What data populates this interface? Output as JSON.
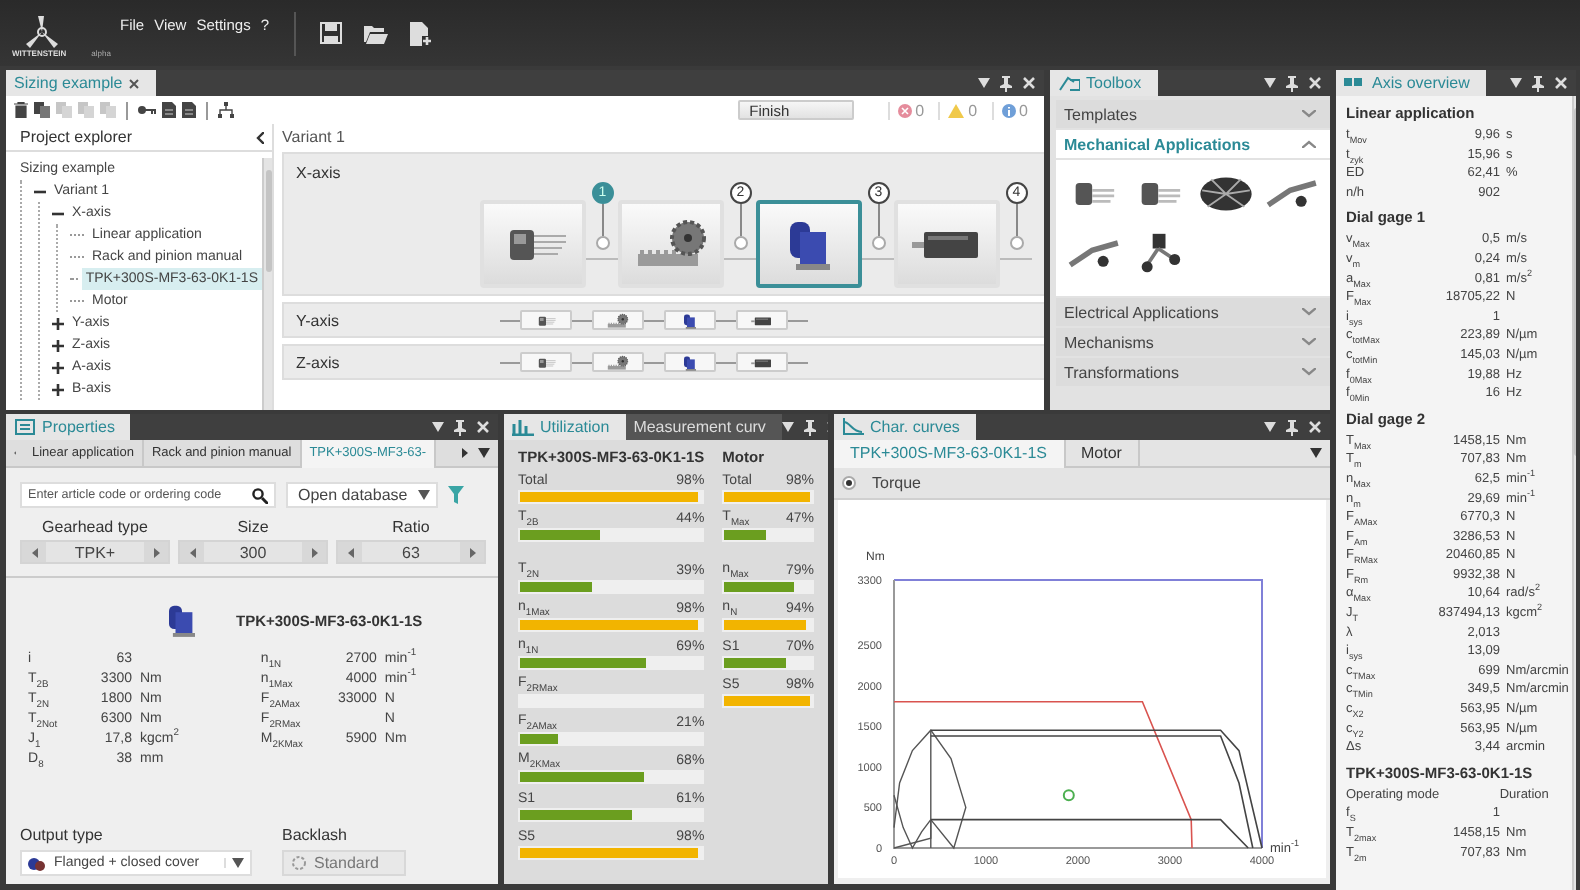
{
  "app": {
    "brand": "WITTENSTEIN",
    "edition": "alpha",
    "menu": [
      "File",
      "View",
      "Settings",
      "?"
    ],
    "toolbar": [
      {
        "kind": "save"
      },
      {
        "kind": "open"
      },
      {
        "kind": "new"
      }
    ]
  },
  "sizing": {
    "tabs": [
      {
        "label": "Sizing example",
        "selected": true
      }
    ],
    "toolbar_groups": [
      {
        "tools": [
          {
            "kind": "delete",
            "disabled": false
          },
          {
            "kind": "copy",
            "disabled": false
          },
          {
            "kind": "copy",
            "disabled": true
          },
          {
            "kind": "copy",
            "disabled": true
          },
          {
            "kind": "copy",
            "disabled": true
          }
        ]
      },
      {
        "tools": [
          {
            "kind": "key",
            "disabled": false
          },
          {
            "kind": "document",
            "disabled": false
          },
          {
            "kind": "document",
            "disabled": false
          }
        ]
      },
      {
        "tools": [
          {
            "kind": "tree",
            "disabled": false
          }
        ]
      }
    ],
    "finish": "Finish",
    "counters": [
      {
        "kind": "error",
        "count": "0"
      },
      {
        "kind": "warning",
        "count": "0"
      },
      {
        "kind": "info",
        "count": "0"
      }
    ],
    "explorer": {
      "title": "Project explorer",
      "tree": [
        {
          "label": "Sizing example",
          "selected": false,
          "children": [
            {
              "label": "Variant 1",
              "expanded": true,
              "selected": false,
              "children": [
                {
                  "label": "X-axis",
                  "expanded": true,
                  "selected": false,
                  "children": [
                    {
                      "label": "Linear application",
                      "selected": false
                    },
                    {
                      "label": "Rack and pinion manual",
                      "selected": false
                    },
                    {
                      "label": "TPK+300S-MF3-63-0K1-1S",
                      "selected": true
                    },
                    {
                      "label": "Motor",
                      "selected": false
                    }
                  ]
                },
                {
                  "label": "Y-axis",
                  "expanded": false,
                  "selected": false
                },
                {
                  "label": "Z-axis",
                  "expanded": false,
                  "selected": false
                },
                {
                  "label": "A-axis",
                  "expanded": false,
                  "selected": false
                },
                {
                  "label": "B-axis",
                  "expanded": false,
                  "selected": false
                }
              ]
            }
          ]
        }
      ]
    },
    "variant": "Variant 1",
    "axes": [
      {
        "label": "X-axis",
        "expanded": true,
        "components": [
          {
            "kind": "application",
            "selected": false,
            "marker": {
              "label": "1",
              "selected": true
            }
          },
          {
            "kind": "rack",
            "selected": false,
            "marker": {
              "label": "2",
              "selected": false
            }
          },
          {
            "kind": "gearbox",
            "selected": true,
            "marker": {
              "label": "3",
              "selected": false
            }
          },
          {
            "kind": "motor",
            "selected": false,
            "marker": {
              "label": "4",
              "selected": false
            }
          }
        ]
      },
      {
        "label": "Y-axis",
        "expanded": false,
        "components": [
          {
            "kind": "application",
            "selected": false
          },
          {
            "kind": "rack",
            "selected": false
          },
          {
            "kind": "gearbox",
            "selected": false
          },
          {
            "kind": "motor",
            "selected": false
          }
        ]
      },
      {
        "label": "Z-axis",
        "expanded": false,
        "components": [
          {
            "kind": "application",
            "selected": false
          },
          {
            "kind": "rack",
            "selected": false
          },
          {
            "kind": "gearbox",
            "selected": false
          },
          {
            "kind": "motor",
            "selected": false
          }
        ]
      }
    ]
  },
  "toolbox": {
    "title": "Toolbox",
    "sections": [
      {
        "label": "Templates",
        "expanded": false
      },
      {
        "label": "Mechanical Applications",
        "expanded": true,
        "tools": [
          {
            "kind": "linear"
          },
          {
            "kind": "linear"
          },
          {
            "kind": "rotary"
          },
          {
            "kind": "crane"
          },
          {
            "kind": "crane"
          },
          {
            "kind": "robot"
          }
        ]
      },
      {
        "label": "Electrical Applications",
        "expanded": false
      },
      {
        "label": "Mechanisms",
        "expanded": false
      },
      {
        "label": "Transformations",
        "expanded": false
      }
    ]
  },
  "properties": {
    "tabs": [
      {
        "label": "Properties",
        "selected": true
      }
    ],
    "subtabs": [
      {
        "label": "Linear application",
        "selected": false
      },
      {
        "label": "Rack and pinion manual",
        "selected": false
      },
      {
        "label": "TPK+300S-MF3-63-",
        "selected": true
      }
    ],
    "search": {
      "placeholder": "Enter article code or ordering code"
    },
    "database": "Open database",
    "selectors": [
      {
        "label": "Gearhead type",
        "value": "TPK+"
      },
      {
        "label": "Size",
        "value": "300"
      },
      {
        "label": "Ratio",
        "value": "63"
      }
    ],
    "product": "TPK+300S-MF3-63-0K1-1S",
    "specs_left": [
      {
        "name": "i",
        "value": "63"
      },
      {
        "name": "T$_{2B}$",
        "value": "3300",
        "unit": "Nm"
      },
      {
        "name": "T$_{2N}$",
        "value": "1800",
        "unit": "Nm"
      },
      {
        "name": "T$_{2Not}$",
        "value": "6300",
        "unit": "Nm"
      },
      {
        "name": "J$_{1}$",
        "value": "17,8",
        "unit": "kgcm$^{2}$"
      },
      {
        "name": "D$_{8}$",
        "value": "38",
        "unit": "mm"
      }
    ],
    "specs_right": [
      {
        "name": "n$_{1N}$",
        "value": "2700",
        "unit": "min$^{-1}$"
      },
      {
        "name": "n$_{1Max}$",
        "value": "4000",
        "unit": "min$^{-1}$"
      },
      {
        "name": "F$_{2AMax}$",
        "value": "33000",
        "unit": "N"
      },
      {
        "name": "F$_{2RMax}$",
        "unit": "N"
      },
      {
        "name": "M$_{2KMax}$",
        "value": "5900",
        "unit": "Nm"
      }
    ],
    "output_type": {
      "label": "Output type",
      "value": "Flanged + closed cover"
    },
    "backlash": {
      "label": "Backlash",
      "value": "Standard"
    }
  },
  "utilization": {
    "tabs": [
      {
        "label": "Utilization",
        "selected": true
      },
      {
        "label": "Measurement curv",
        "selected": false
      }
    ],
    "columns": [
      {
        "title": "TPK+300S-MF3-63-0K1-1S",
        "bars": [
          {
            "name": "Total",
            "value": "98%",
            "level": 0.98,
            "color": "#f2b400"
          },
          {
            "name": "T$_{2B}$",
            "value": "44%",
            "level": 0.44,
            "color": "#6b9e1f"
          },
          {
            "name": "T$_{2N}$",
            "value": "39%",
            "level": 0.39,
            "color": "#6b9e1f"
          },
          {
            "name": "n$_{1Max}$",
            "value": "98%",
            "level": 0.98,
            "color": "#f2b400"
          },
          {
            "name": "n$_{1N}$",
            "value": "69%",
            "level": 0.69,
            "color": "#6b9e1f"
          },
          {
            "name": "F$_{2RMax}$"
          },
          {
            "name": "F$_{2AMax}$",
            "value": "21%",
            "level": 0.21,
            "color": "#6b9e1f"
          },
          {
            "name": "M$_{2KMax}$",
            "value": "68%",
            "level": 0.68,
            "color": "#6b9e1f"
          },
          {
            "name": "S1",
            "value": "61%",
            "level": 0.61,
            "color": "#6b9e1f"
          },
          {
            "name": "S5",
            "value": "98%",
            "level": 0.98,
            "color": "#f2b400"
          }
        ]
      },
      {
        "title": "Motor",
        "bars": [
          {
            "name": "Total",
            "value": "98%",
            "level": 0.98,
            "color": "#f2b400"
          },
          {
            "name": "T$_{Max}$",
            "value": "47%",
            "level": 0.47,
            "color": "#6b9e1f"
          },
          {
            "name": "n$_{Max}$",
            "value": "79%",
            "level": 0.79,
            "color": "#6b9e1f"
          },
          {
            "name": "n$_{N}$",
            "value": "94%",
            "level": 0.94,
            "color": "#f2b400"
          },
          {
            "name": "S1",
            "value": "70%",
            "level": 0.7,
            "color": "#6b9e1f"
          },
          {
            "name": "S5",
            "value": "98%",
            "level": 0.98,
            "color": "#f2b400"
          }
        ]
      }
    ]
  },
  "char_curves": {
    "tabs": [
      {
        "label": "Char. curves",
        "selected": true
      }
    ],
    "subtabs": [
      {
        "label": "TPK+300S-MF3-63-0K1-1S",
        "selected": true
      },
      {
        "label": "Motor",
        "selected": false
      }
    ],
    "options": [
      {
        "label": "Torque",
        "selected": true
      }
    ],
    "chart_data": {
      "type": "line",
      "ylabel": "Nm",
      "xlabel": "min$^{-1}$",
      "x": [
        0,
        400,
        1900,
        2700,
        3230,
        3240,
        3550,
        3750,
        3850,
        3900,
        4000
      ],
      "xlim": [
        0,
        4000
      ],
      "ylim": [
        0,
        3300
      ],
      "xticks": [
        0,
        1000,
        2000,
        3000,
        4000
      ],
      "yticks": [
        0,
        500,
        1000,
        1500,
        2000,
        2500,
        3300
      ],
      "series": [
        {
          "color": "#d9534f",
          "values": [
            1800,
            1800,
            1800,
            1800,
            350,
            0,
            null,
            null,
            null,
            null,
            null
          ]
        },
        {
          "color": "#444444",
          "values": [
            null,
            1450,
            1450,
            1450,
            1450,
            1450,
            1450,
            1200,
            null,
            null,
            0
          ]
        },
        {
          "color": "#444444",
          "values": [
            null,
            1380,
            1380,
            1380,
            1380,
            1380,
            1380,
            800,
            null,
            0,
            null
          ]
        },
        {
          "color": "#444444",
          "values": [
            null,
            350,
            350,
            350,
            350,
            350,
            350,
            null,
            0,
            null,
            null
          ]
        },
        {
          "color": "#4caf50",
          "marker": "circle",
          "values": [
            null,
            null,
            650,
            null,
            null,
            null,
            null,
            null,
            null,
            null,
            null
          ]
        }
      ]
    }
  },
  "axis_overview": {
    "title": "Axis overview",
    "sections": [
      {
        "title": "Linear application",
        "rows": [
          {
            "name": "t$_{Mov}$",
            "value": "9,96",
            "unit": "s"
          },
          {
            "name": "t$_{zyk}$",
            "value": "15,96",
            "unit": "s"
          },
          {
            "name": "ED",
            "value": "62,41",
            "unit": "%"
          },
          {
            "name": "n/h",
            "value": "902"
          }
        ]
      },
      {
        "title": "Dial gage 1",
        "rows": [
          {
            "name": "v$_{Max}$",
            "value": "0,5",
            "unit": "m/s"
          },
          {
            "name": "v$_{m}$",
            "value": "0,24",
            "unit": "m/s"
          },
          {
            "name": "a$_{Max}$",
            "value": "0,81",
            "unit": "m/s$^{2}$"
          },
          {
            "name": "F$_{Max}$",
            "value": "18705,22",
            "unit": "N"
          },
          {
            "name": "i$_{sys}$",
            "value": "1"
          },
          {
            "name": "c$_{totMax}$",
            "value": "223,89",
            "unit": "N/µm"
          },
          {
            "name": "c$_{totMin}$",
            "value": "145,03",
            "unit": "N/µm"
          },
          {
            "name": "f$_{0Max}$",
            "value": "19,88",
            "unit": "Hz"
          },
          {
            "name": "f$_{0Min}$",
            "value": "16",
            "unit": "Hz"
          }
        ]
      },
      {
        "title": "Dial gage 2",
        "rows": [
          {
            "name": "T$_{Max}$",
            "value": "1458,15",
            "unit": "Nm"
          },
          {
            "name": "T$_{m}$",
            "value": "707,83",
            "unit": "Nm"
          },
          {
            "name": "n$_{Max}$",
            "value": "62,5",
            "unit": "min$^{-1}$"
          },
          {
            "name": "n$_{m}$",
            "value": "29,69",
            "unit": "min$^{-1}$"
          },
          {
            "name": "F$_{AMax}$",
            "value": "6770,3",
            "unit": "N"
          },
          {
            "name": "F$_{Am}$",
            "value": "3286,53",
            "unit": "N"
          },
          {
            "name": "F$_{RMax}$",
            "value": "20460,85",
            "unit": "N"
          },
          {
            "name": "F$_{Rm}$",
            "value": "9932,38",
            "unit": "N"
          },
          {
            "name": "α$_{Max}$",
            "value": "10,64",
            "unit": "rad/s$^{2}$"
          },
          {
            "name": "J$_{T}$",
            "value": "837494,13",
            "unit": "kgcm$^{2}$"
          },
          {
            "name": "λ",
            "value": "2,013"
          },
          {
            "name": "i$_{sys}$",
            "value": "13,09"
          },
          {
            "name": "c$_{TMax}$",
            "value": "699",
            "unit": "Nm/arcmin"
          },
          {
            "name": "c$_{TMin}$",
            "value": "349,5",
            "unit": "Nm/arcmin"
          },
          {
            "name": "c$_{X2}$",
            "value": "563,95",
            "unit": "N/µm"
          },
          {
            "name": "c$_{Y2}$",
            "value": "563,95",
            "unit": "N/µm"
          },
          {
            "name": "Δs",
            "value": "3,44",
            "unit": "arcmin"
          }
        ]
      },
      {
        "title": "TPK+300S-MF3-63-0K1-1S",
        "columns": [
          "Operating mode",
          "Duration"
        ],
        "rows": [
          {
            "name": "f$_{S}$",
            "value": "1"
          },
          {
            "name": "T$_{2max}$",
            "value": "1458,15",
            "unit": "Nm"
          },
          {
            "name": "T$_{2m}$",
            "value": "707,83",
            "unit": "Nm"
          }
        ]
      }
    ]
  }
}
